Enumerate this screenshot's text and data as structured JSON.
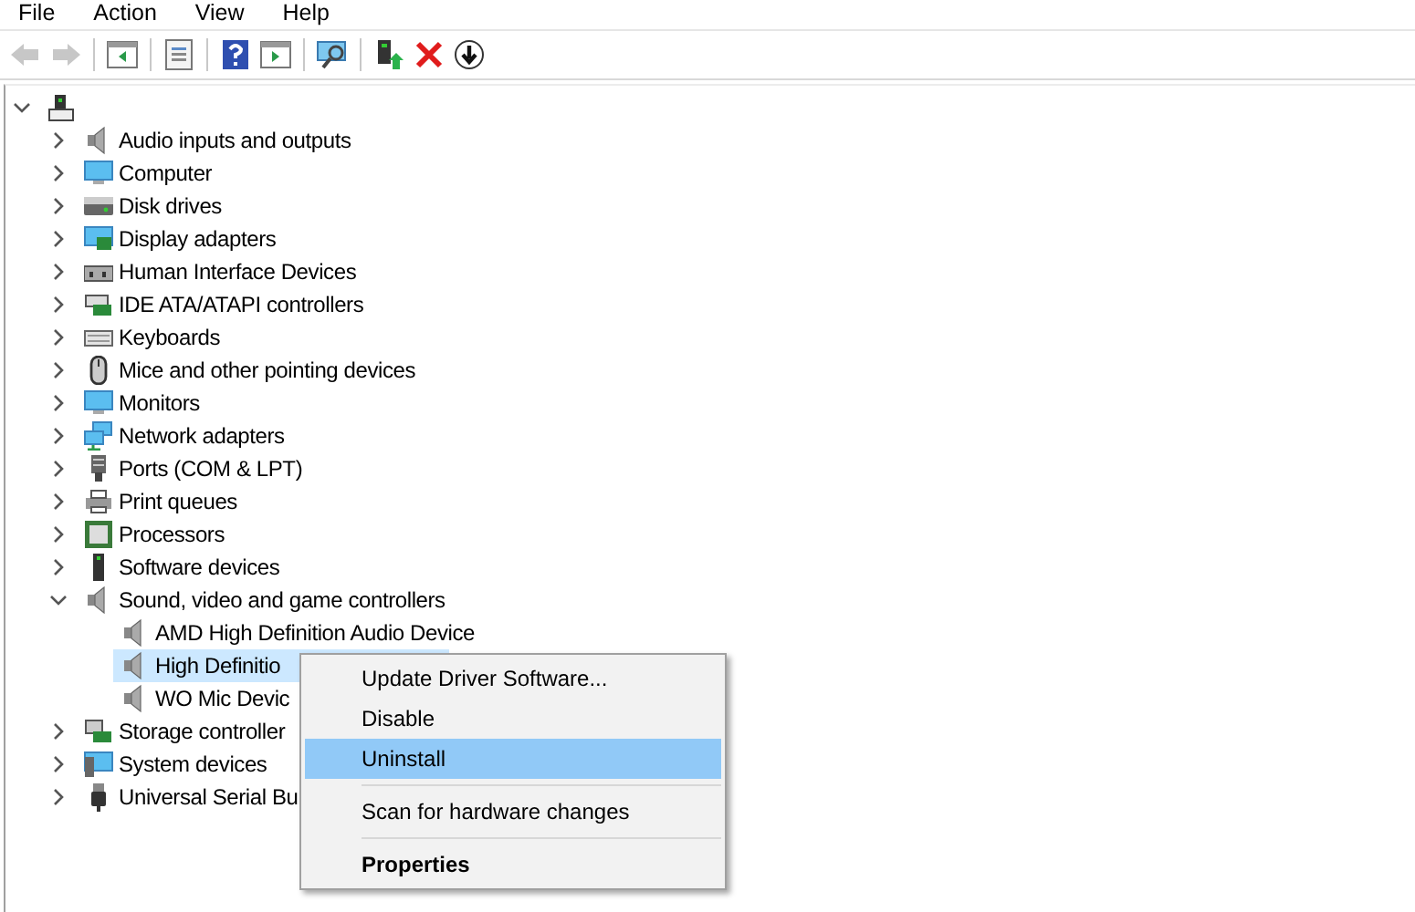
{
  "menu_bar": [
    "File",
    "Action",
    "View",
    "Help"
  ],
  "toolbar": [
    {
      "kind": "button",
      "disabled": true
    },
    {
      "kind": "button",
      "disabled": true
    },
    {
      "kind": "separator"
    },
    {
      "kind": "button",
      "disabled": false
    },
    {
      "kind": "separator"
    },
    {
      "kind": "button",
      "disabled": false
    },
    {
      "kind": "separator"
    },
    {
      "kind": "button",
      "disabled": false
    },
    {
      "kind": "button",
      "disabled": false
    },
    {
      "kind": "separator"
    },
    {
      "kind": "button",
      "disabled": false
    },
    {
      "kind": "separator"
    },
    {
      "kind": "button",
      "disabled": false
    },
    {
      "kind": "button",
      "disabled": false
    },
    {
      "kind": "button",
      "disabled": false
    }
  ],
  "tree": {
    "expanded": true,
    "children": [
      {
        "label": "Audio inputs and outputs",
        "expanded": false
      },
      {
        "label": "Computer",
        "expanded": false
      },
      {
        "label": "Disk drives",
        "expanded": false
      },
      {
        "label": "Display adapters",
        "expanded": false
      },
      {
        "label": "Human Interface Devices",
        "expanded": false
      },
      {
        "label": "IDE ATA/ATAPI controllers",
        "expanded": false
      },
      {
        "label": "Keyboards",
        "expanded": false
      },
      {
        "label": "Mice and other pointing devices",
        "expanded": false
      },
      {
        "label": "Monitors",
        "expanded": false
      },
      {
        "label": "Network adapters",
        "expanded": false
      },
      {
        "label": "Ports (COM & LPT)",
        "expanded": false
      },
      {
        "label": "Print queues",
        "expanded": false
      },
      {
        "label": "Processors",
        "expanded": false
      },
      {
        "label": "Software devices",
        "expanded": false
      },
      {
        "label": "Sound, video and game controllers",
        "expanded": true,
        "children": [
          {
            "label": "AMD High Definition Audio Device",
            "selected": false
          },
          {
            "label": "High Definitio",
            "selected": true
          },
          {
            "label": "WO Mic Devic",
            "selected": false
          }
        ]
      },
      {
        "label": "Storage controller",
        "expanded": false
      },
      {
        "label": "System devices",
        "expanded": false
      },
      {
        "label": "Universal Serial Bu",
        "expanded": false
      }
    ]
  },
  "context_menu": [
    {
      "kind": "item",
      "label": "Update Driver Software...",
      "selected": false
    },
    {
      "kind": "item",
      "label": "Disable",
      "selected": false
    },
    {
      "kind": "item",
      "label": "Uninstall",
      "selected": true
    },
    {
      "kind": "separator"
    },
    {
      "kind": "item",
      "label": "Scan for hardware changes",
      "selected": false
    },
    {
      "kind": "separator"
    },
    {
      "kind": "default",
      "label": "Properties",
      "selected": false
    }
  ]
}
